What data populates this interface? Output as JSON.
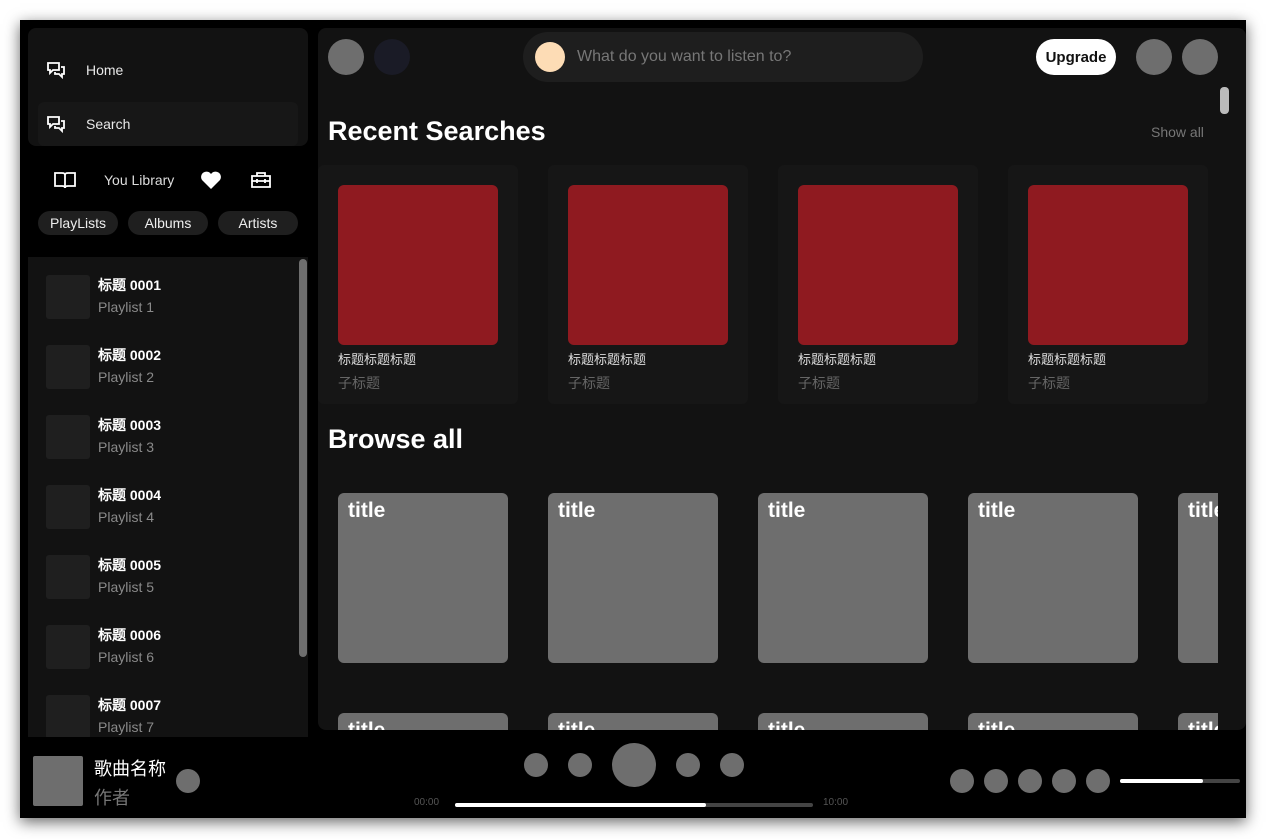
{
  "sidebar": {
    "nav": [
      {
        "label": "Home",
        "icon": "chat-bubbles-icon"
      },
      {
        "label": "Search",
        "icon": "chat-bubbles-icon"
      }
    ],
    "library": {
      "label": "You Library",
      "icons": [
        "book-icon",
        "heart-icon",
        "toolbox-icon"
      ]
    },
    "filters": [
      "PlayLists",
      "Albums",
      "Artists"
    ],
    "playlists": [
      {
        "title": "标题 0001",
        "subtitle": "Playlist 1"
      },
      {
        "title": "标题 0002",
        "subtitle": "Playlist 2"
      },
      {
        "title": "标题 0003",
        "subtitle": "Playlist 3"
      },
      {
        "title": "标题 0004",
        "subtitle": "Playlist 4"
      },
      {
        "title": "标题 0005",
        "subtitle": "Playlist 5"
      },
      {
        "title": "标题 0006",
        "subtitle": "Playlist 6"
      },
      {
        "title": "标题 0007",
        "subtitle": "Playlist 7"
      }
    ]
  },
  "header": {
    "search_placeholder": "What do you want to listen to?",
    "upgrade": "Upgrade"
  },
  "recent": {
    "title": "Recent Searches",
    "show_all": "Show all",
    "cards": [
      {
        "title": "标题标题标题",
        "subtitle": "子标题"
      },
      {
        "title": "标题标题标题",
        "subtitle": "子标题"
      },
      {
        "title": "标题标题标题",
        "subtitle": "子标题"
      },
      {
        "title": "标题标题标题",
        "subtitle": "子标题"
      }
    ]
  },
  "browse": {
    "title": "Browse all",
    "tiles": [
      "title",
      "title",
      "title",
      "title",
      "title",
      "title",
      "title",
      "title",
      "title",
      "title"
    ]
  },
  "player": {
    "song": "歌曲名称",
    "artist": "作者",
    "time_current": "00:00",
    "time_total": "10:00",
    "progress": 0.7,
    "volume": 0.69
  },
  "colors": {
    "accent_card": "#8f1a20",
    "tile": "#6e6e6e",
    "panel": "#121212"
  }
}
